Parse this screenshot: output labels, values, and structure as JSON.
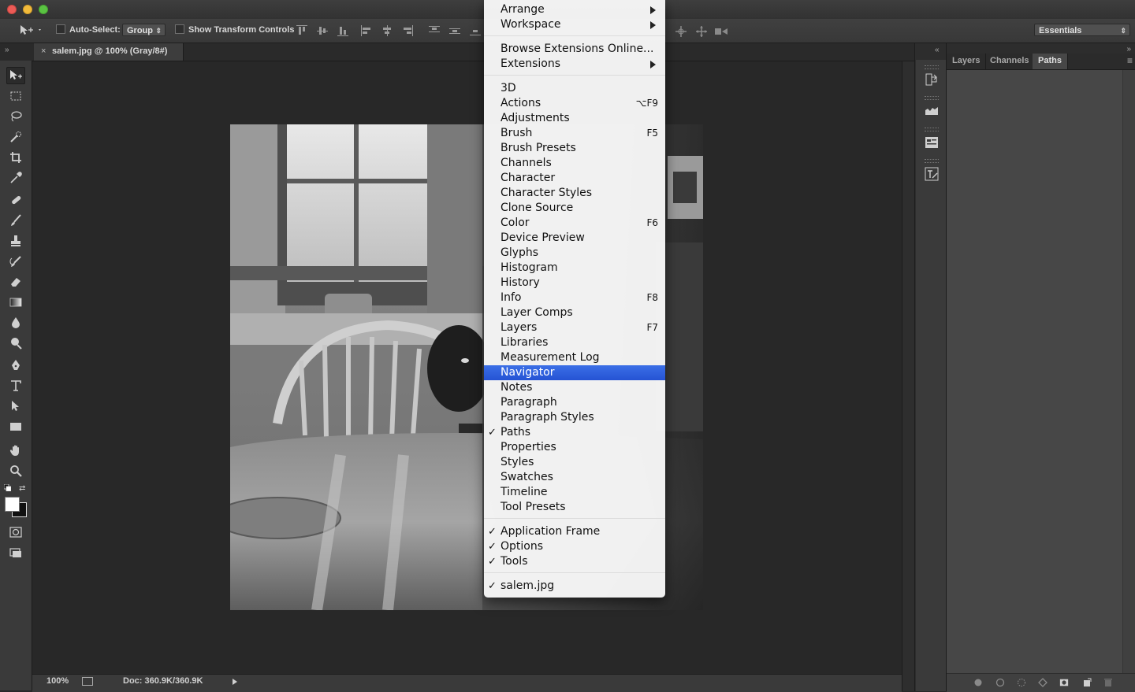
{
  "options_bar": {
    "auto_select_label": "Auto-Select:",
    "auto_select_value": "Group",
    "show_transform_label": "Show Transform Controls",
    "workspace_value": "Essentials"
  },
  "document": {
    "tab_title": "salem.jpg @ 100% (Gray/8#)",
    "close_glyph": "×"
  },
  "status_bar": {
    "zoom": "100%",
    "doc_info": "Doc: 360.9K/360.9K"
  },
  "panel": {
    "tabs": [
      "Layers",
      "Channels",
      "Paths"
    ],
    "active_tab": "Paths"
  },
  "menu": {
    "items": [
      {
        "label": "Arrange",
        "submenu": true
      },
      {
        "label": "Workspace",
        "submenu": true
      },
      {
        "label": "Browse Extensions Online..."
      },
      {
        "label": "Extensions",
        "submenu": true
      },
      {
        "label": "3D"
      },
      {
        "label": "Actions",
        "shortcut": "⌥F9"
      },
      {
        "label": "Adjustments"
      },
      {
        "label": "Brush",
        "shortcut": "F5"
      },
      {
        "label": "Brush Presets"
      },
      {
        "label": "Channels"
      },
      {
        "label": "Character"
      },
      {
        "label": "Character Styles"
      },
      {
        "label": "Clone Source"
      },
      {
        "label": "Color",
        "shortcut": "F6"
      },
      {
        "label": "Device Preview"
      },
      {
        "label": "Glyphs"
      },
      {
        "label": "Histogram"
      },
      {
        "label": "History"
      },
      {
        "label": "Info",
        "shortcut": "F8"
      },
      {
        "label": "Layer Comps"
      },
      {
        "label": "Layers",
        "shortcut": "F7"
      },
      {
        "label": "Libraries"
      },
      {
        "label": "Measurement Log"
      },
      {
        "label": "Navigator",
        "highlighted": true
      },
      {
        "label": "Notes"
      },
      {
        "label": "Paragraph"
      },
      {
        "label": "Paragraph Styles"
      },
      {
        "label": "Paths",
        "checked": true
      },
      {
        "label": "Properties"
      },
      {
        "label": "Styles"
      },
      {
        "label": "Swatches"
      },
      {
        "label": "Timeline"
      },
      {
        "label": "Tool Presets"
      },
      {
        "label": "Application Frame",
        "checked": true
      },
      {
        "label": "Options",
        "checked": true
      },
      {
        "label": "Tools",
        "checked": true
      },
      {
        "label": "salem.jpg",
        "checked": true
      }
    ],
    "check_glyph": "✓"
  },
  "colors": {
    "menu_highlight": "#2f62e0",
    "app_background": "#282828",
    "panel_background": "#474747"
  }
}
